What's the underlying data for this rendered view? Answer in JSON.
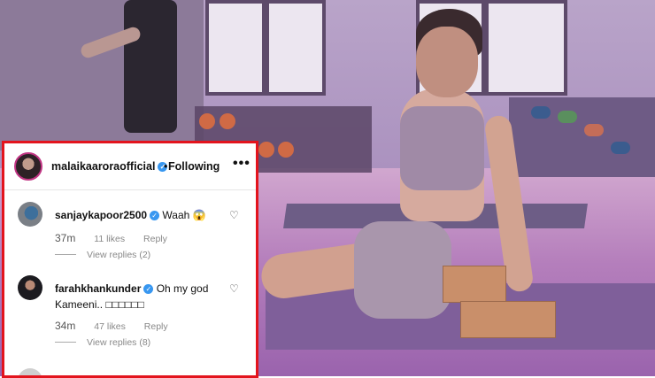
{
  "post_header": {
    "username": "malaikaaroraofficial",
    "verified_icon": "verified-badge-icon",
    "separator": "•",
    "follow_status": "Following",
    "more_label": "•••"
  },
  "comments": [
    {
      "username": "sanjaykapoor2500",
      "text": "Waah",
      "emoji": "😱",
      "time": "37m",
      "likes": "11 likes",
      "reply_label": "Reply",
      "view_replies": "View replies (2)"
    },
    {
      "username": "farahkhankunder",
      "text": "Oh my god Kameeni.. □□□□□□",
      "time": "34m",
      "likes": "47 likes",
      "reply_label": "Reply",
      "view_replies": "View replies (8)"
    }
  ],
  "colors": {
    "highlight_border": "#e3141d",
    "verified_blue": "#3897f0"
  }
}
